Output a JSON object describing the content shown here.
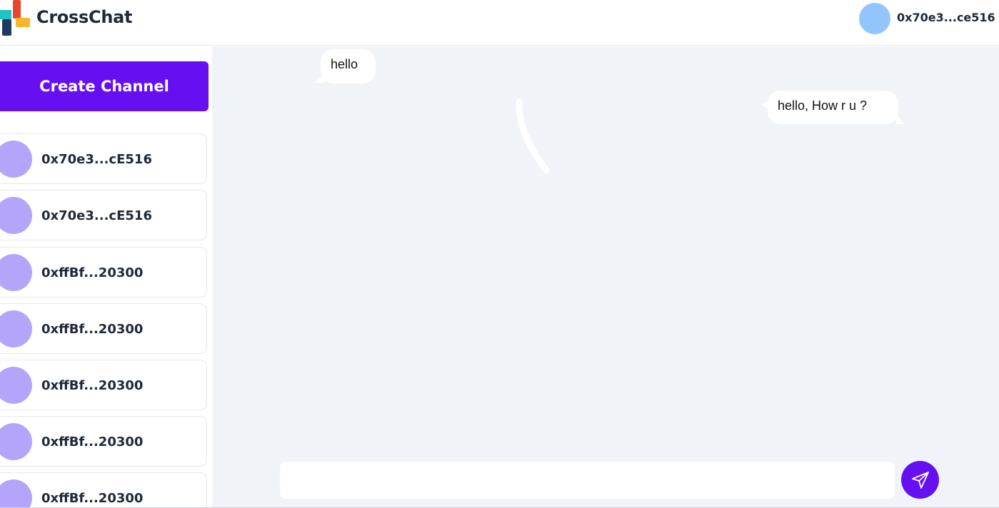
{
  "header": {
    "brand": "CrossChat",
    "user_address": "0x70e3...ce516"
  },
  "sidebar": {
    "create_channel_label": "Create Channel",
    "channels": [
      {
        "name": "0x70e3...cE516"
      },
      {
        "name": "0x70e3...cE516"
      },
      {
        "name": "0xffBf...20300"
      },
      {
        "name": "0xffBf...20300"
      },
      {
        "name": "0xffBf...20300"
      },
      {
        "name": "0xffBf...20300"
      },
      {
        "name": "0xffBf...20300"
      }
    ]
  },
  "chat": {
    "messages": [
      {
        "text": "hello",
        "side": "left"
      },
      {
        "text": "hello, How r u ?",
        "side": "right"
      }
    ],
    "input": {
      "value": "",
      "placeholder": ""
    }
  },
  "colors": {
    "accent": "#6610f2",
    "channel_avatar": "#b4a5fb",
    "user_avatar": "#93c5fd",
    "chat_background": "#f0f4f8"
  },
  "icons": {
    "logo": "crosschat-logo-icon",
    "send": "send-icon"
  }
}
